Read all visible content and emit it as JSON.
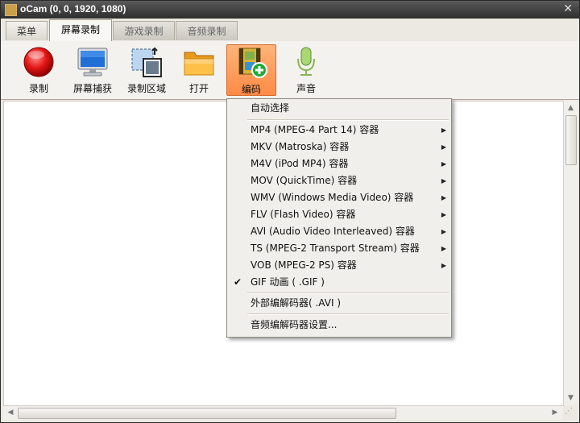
{
  "window": {
    "title": "oCam (0, 0, 1920, 1080)"
  },
  "tabs": [
    {
      "label": "菜单",
      "state": "normal"
    },
    {
      "label": "屏幕录制",
      "state": "active"
    },
    {
      "label": "游戏录制",
      "state": "inactive"
    },
    {
      "label": "音频录制",
      "state": "inactive"
    }
  ],
  "toolbar": [
    {
      "label": "录制",
      "icon": "record-icon"
    },
    {
      "label": "屏幕捕获",
      "icon": "monitor-icon"
    },
    {
      "label": "录制区域",
      "icon": "region-icon"
    },
    {
      "label": "打开",
      "icon": "folder-icon"
    },
    {
      "label": "编码",
      "icon": "film-add-icon",
      "selected": true
    },
    {
      "label": "声音",
      "icon": "microphone-icon"
    }
  ],
  "menu": {
    "auto": "自动选择",
    "formats": [
      "MP4 (MPEG-4 Part 14) 容器",
      "MKV (Matroska) 容器",
      "M4V (iPod MP4) 容器",
      "MOV (QuickTime) 容器",
      "WMV (Windows Media Video) 容器",
      "FLV (Flash Video) 容器",
      "AVI (Audio Video Interleaved) 容器",
      "TS (MPEG-2 Transport Stream) 容器",
      "VOB (MPEG-2 PS) 容器"
    ],
    "gif": "GIF 动画 ( .GIF )",
    "external": "外部编解码器( .AVI )",
    "audio_settings": "音频编解码器设置..."
  },
  "colors": {
    "accent": "#ff8a45",
    "titlebar": "#2e2e2e"
  }
}
